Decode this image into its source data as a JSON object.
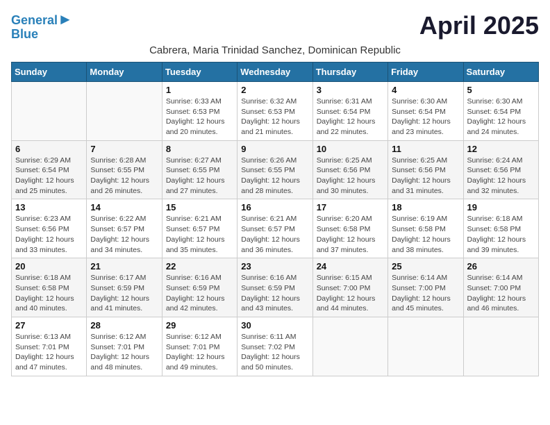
{
  "header": {
    "logo_line1": "General",
    "logo_line2": "Blue",
    "month_title": "April 2025",
    "subtitle": "Cabrera, Maria Trinidad Sanchez, Dominican Republic"
  },
  "weekdays": [
    "Sunday",
    "Monday",
    "Tuesday",
    "Wednesday",
    "Thursday",
    "Friday",
    "Saturday"
  ],
  "weeks": [
    [
      {
        "day": "",
        "info": ""
      },
      {
        "day": "",
        "info": ""
      },
      {
        "day": "1",
        "info": "Sunrise: 6:33 AM\nSunset: 6:53 PM\nDaylight: 12 hours and 20 minutes."
      },
      {
        "day": "2",
        "info": "Sunrise: 6:32 AM\nSunset: 6:53 PM\nDaylight: 12 hours and 21 minutes."
      },
      {
        "day": "3",
        "info": "Sunrise: 6:31 AM\nSunset: 6:54 PM\nDaylight: 12 hours and 22 minutes."
      },
      {
        "day": "4",
        "info": "Sunrise: 6:30 AM\nSunset: 6:54 PM\nDaylight: 12 hours and 23 minutes."
      },
      {
        "day": "5",
        "info": "Sunrise: 6:30 AM\nSunset: 6:54 PM\nDaylight: 12 hours and 24 minutes."
      }
    ],
    [
      {
        "day": "6",
        "info": "Sunrise: 6:29 AM\nSunset: 6:54 PM\nDaylight: 12 hours and 25 minutes."
      },
      {
        "day": "7",
        "info": "Sunrise: 6:28 AM\nSunset: 6:55 PM\nDaylight: 12 hours and 26 minutes."
      },
      {
        "day": "8",
        "info": "Sunrise: 6:27 AM\nSunset: 6:55 PM\nDaylight: 12 hours and 27 minutes."
      },
      {
        "day": "9",
        "info": "Sunrise: 6:26 AM\nSunset: 6:55 PM\nDaylight: 12 hours and 28 minutes."
      },
      {
        "day": "10",
        "info": "Sunrise: 6:25 AM\nSunset: 6:56 PM\nDaylight: 12 hours and 30 minutes."
      },
      {
        "day": "11",
        "info": "Sunrise: 6:25 AM\nSunset: 6:56 PM\nDaylight: 12 hours and 31 minutes."
      },
      {
        "day": "12",
        "info": "Sunrise: 6:24 AM\nSunset: 6:56 PM\nDaylight: 12 hours and 32 minutes."
      }
    ],
    [
      {
        "day": "13",
        "info": "Sunrise: 6:23 AM\nSunset: 6:56 PM\nDaylight: 12 hours and 33 minutes."
      },
      {
        "day": "14",
        "info": "Sunrise: 6:22 AM\nSunset: 6:57 PM\nDaylight: 12 hours and 34 minutes."
      },
      {
        "day": "15",
        "info": "Sunrise: 6:21 AM\nSunset: 6:57 PM\nDaylight: 12 hours and 35 minutes."
      },
      {
        "day": "16",
        "info": "Sunrise: 6:21 AM\nSunset: 6:57 PM\nDaylight: 12 hours and 36 minutes."
      },
      {
        "day": "17",
        "info": "Sunrise: 6:20 AM\nSunset: 6:58 PM\nDaylight: 12 hours and 37 minutes."
      },
      {
        "day": "18",
        "info": "Sunrise: 6:19 AM\nSunset: 6:58 PM\nDaylight: 12 hours and 38 minutes."
      },
      {
        "day": "19",
        "info": "Sunrise: 6:18 AM\nSunset: 6:58 PM\nDaylight: 12 hours and 39 minutes."
      }
    ],
    [
      {
        "day": "20",
        "info": "Sunrise: 6:18 AM\nSunset: 6:58 PM\nDaylight: 12 hours and 40 minutes."
      },
      {
        "day": "21",
        "info": "Sunrise: 6:17 AM\nSunset: 6:59 PM\nDaylight: 12 hours and 41 minutes."
      },
      {
        "day": "22",
        "info": "Sunrise: 6:16 AM\nSunset: 6:59 PM\nDaylight: 12 hours and 42 minutes."
      },
      {
        "day": "23",
        "info": "Sunrise: 6:16 AM\nSunset: 6:59 PM\nDaylight: 12 hours and 43 minutes."
      },
      {
        "day": "24",
        "info": "Sunrise: 6:15 AM\nSunset: 7:00 PM\nDaylight: 12 hours and 44 minutes."
      },
      {
        "day": "25",
        "info": "Sunrise: 6:14 AM\nSunset: 7:00 PM\nDaylight: 12 hours and 45 minutes."
      },
      {
        "day": "26",
        "info": "Sunrise: 6:14 AM\nSunset: 7:00 PM\nDaylight: 12 hours and 46 minutes."
      }
    ],
    [
      {
        "day": "27",
        "info": "Sunrise: 6:13 AM\nSunset: 7:01 PM\nDaylight: 12 hours and 47 minutes."
      },
      {
        "day": "28",
        "info": "Sunrise: 6:12 AM\nSunset: 7:01 PM\nDaylight: 12 hours and 48 minutes."
      },
      {
        "day": "29",
        "info": "Sunrise: 6:12 AM\nSunset: 7:01 PM\nDaylight: 12 hours and 49 minutes."
      },
      {
        "day": "30",
        "info": "Sunrise: 6:11 AM\nSunset: 7:02 PM\nDaylight: 12 hours and 50 minutes."
      },
      {
        "day": "",
        "info": ""
      },
      {
        "day": "",
        "info": ""
      },
      {
        "day": "",
        "info": ""
      }
    ]
  ]
}
